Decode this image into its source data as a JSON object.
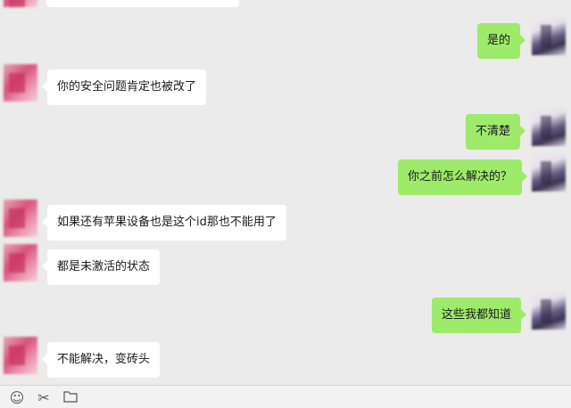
{
  "messages": [
    {
      "side": "right",
      "text": "是的"
    },
    {
      "side": "left",
      "text": "你的安全问题肯定也被改了"
    },
    {
      "side": "right",
      "text": "不清楚"
    },
    {
      "side": "right",
      "text": "你之前怎么解决的？"
    },
    {
      "side": "left",
      "text": "如果还有苹果设备也是这个id那也不能用了"
    },
    {
      "side": "left",
      "text": "都是未激活的状态"
    },
    {
      "side": "right",
      "text": "这些我都知道"
    },
    {
      "side": "left",
      "text": "不能解决，变砖头"
    }
  ],
  "toolbar": {
    "icons": [
      "emoji-icon",
      "scissors-icon",
      "folder-icon"
    ]
  },
  "colors": {
    "background": "#ebebeb",
    "incoming_bubble": "#ffffff",
    "outgoing_bubble": "#9eea6a"
  }
}
